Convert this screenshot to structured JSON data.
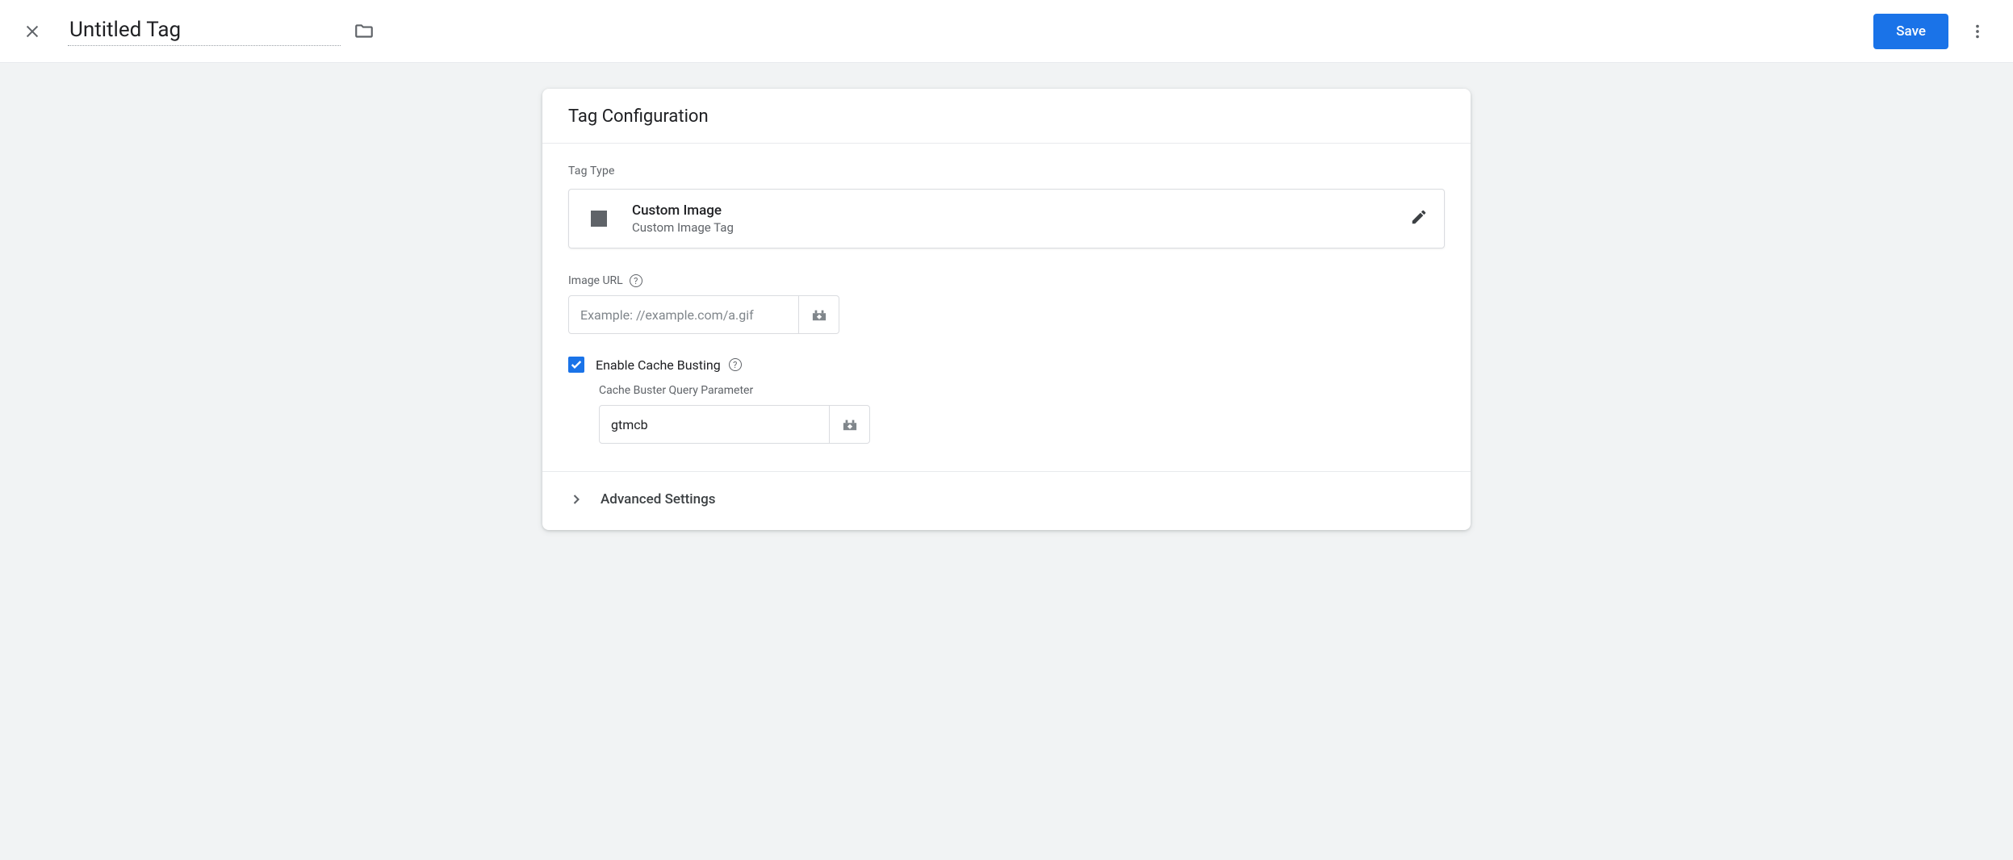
{
  "header": {
    "title": "Untitled Tag",
    "save_label": "Save"
  },
  "card": {
    "title": "Tag Configuration",
    "tag_type_label": "Tag Type",
    "tag_type": {
      "name": "Custom Image",
      "subtitle": "Custom Image Tag"
    },
    "image_url": {
      "label": "Image URL",
      "placeholder": "Example: //example.com/a.gif",
      "value": ""
    },
    "cache_busting": {
      "label": "Enable Cache Busting",
      "checked": true,
      "param_label": "Cache Buster Query Parameter",
      "param_value": "gtmcb"
    },
    "advanced_label": "Advanced Settings"
  }
}
